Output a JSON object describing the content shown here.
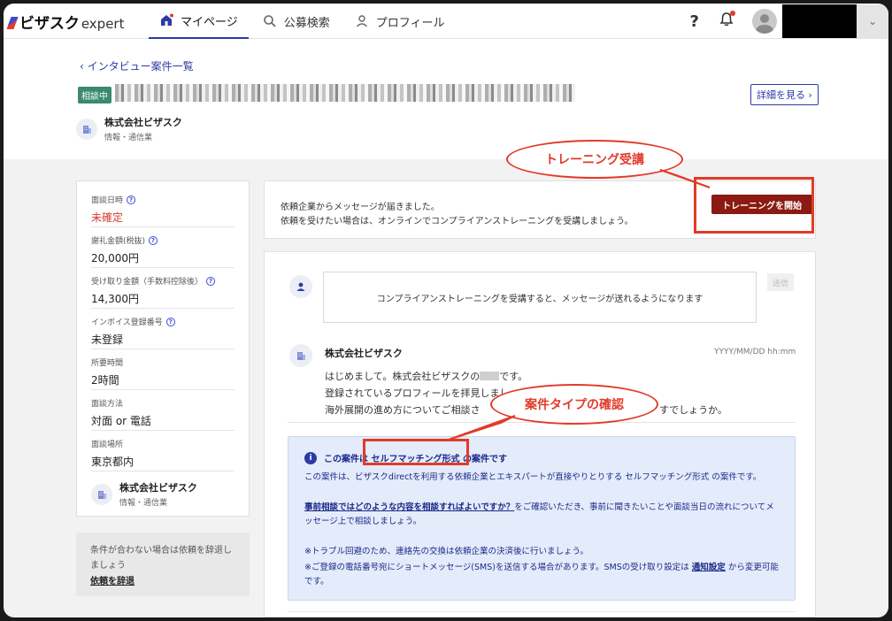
{
  "nav": {
    "logo": "ビザスク",
    "logo_sub": "expert",
    "items": [
      {
        "label": "マイページ",
        "icon": "home-icon",
        "active": true
      },
      {
        "label": "公募検索",
        "icon": "search-icon",
        "active": false
      },
      {
        "label": "プロフィール",
        "icon": "user-icon",
        "active": false
      }
    ],
    "help": "?",
    "dropdown": "⌄"
  },
  "header": {
    "back": "‹  インタビュー案件一覧",
    "status": "相談中",
    "detail_button": "詳細を見る  ›",
    "company_name": "株式会社ビザスク",
    "company_industry": "情報・通信業"
  },
  "left": {
    "fields": [
      {
        "label": "面談日時",
        "value": "未確定",
        "help": true,
        "red": true
      },
      {
        "label": "謝礼金額(税抜)",
        "value": "20,000円",
        "help": true,
        "red": false
      },
      {
        "label": "受け取り金額（手数料控除後）",
        "value": "14,300円",
        "help": true,
        "red": false
      },
      {
        "label": "インボイス登録番号",
        "value": "未登録",
        "help": true,
        "red": false
      },
      {
        "label": "所要時間",
        "value": "2時間",
        "help": false,
        "red": false
      },
      {
        "label": "面談方法",
        "value": "対面 or 電話",
        "help": false,
        "red": false
      },
      {
        "label": "面談場所",
        "value": "東京都内",
        "help": false,
        "red": false
      }
    ],
    "company_name": "株式会社ビザスク",
    "company_industry": "情報・通信業",
    "decline_text": "条件が合わない場合は依頼を辞退しましょう",
    "decline_link": "依頼を辞退"
  },
  "message": {
    "line1": "依頼企業からメッセージが届きました。",
    "line2": "依頼を受けたい場合は、オンラインでコンプライアンストレーニングを受講しましょう。",
    "button": "トレーニングを開始"
  },
  "callouts": {
    "training": "トレーニング受講",
    "type": "案件タイプの確認"
  },
  "chat": {
    "compose_text": "コンプライアンストレーニングを受講すると、メッセージが送れるようになります",
    "send": "送信",
    "sender": "株式会社ビザスク",
    "time": "YYYY/MM/DD hh:mm",
    "line1": "はじめまして。株式会社ビザスクの",
    "line1_end": "です。",
    "line2": "登録されているプロフィールを拝見しまし",
    "line3a": "海外展開の進め方についてご相談さ",
    "line3b": "すでしょうか。"
  },
  "info": {
    "title_a": "この案件は",
    "title_b": "セルフマッチング形式",
    "title_c": "の案件です",
    "p1": "この案件は、ビザスクdirectを利用する依頼企業とエキスパートが直接やりとりする セルフマッチング形式 の案件です。",
    "p2_link": "事前相談ではどのような内容を相談すればよいですか？",
    "p2_rest": "をご確認いただき、事前に聞きたいことや面談当日の流れについてメッセージ上で相談しましょう。",
    "p3": "※トラブル回避のため、連絡先の交換は依頼企業の決済後に行いましょう。",
    "p4a": "※ご登録の電話番号宛にショートメッセージ(SMS)を送信する場合があります。SMSの受け取り設定は",
    "p4_link": "通知設定",
    "p4b": "から変更可能です。"
  },
  "colors": {
    "accent": "#2b3aa6",
    "highlight": "#e13b29",
    "training_button": "#8b1a12",
    "status_badge": "#3b8a6d",
    "info_bg": "#e4ebfa"
  }
}
